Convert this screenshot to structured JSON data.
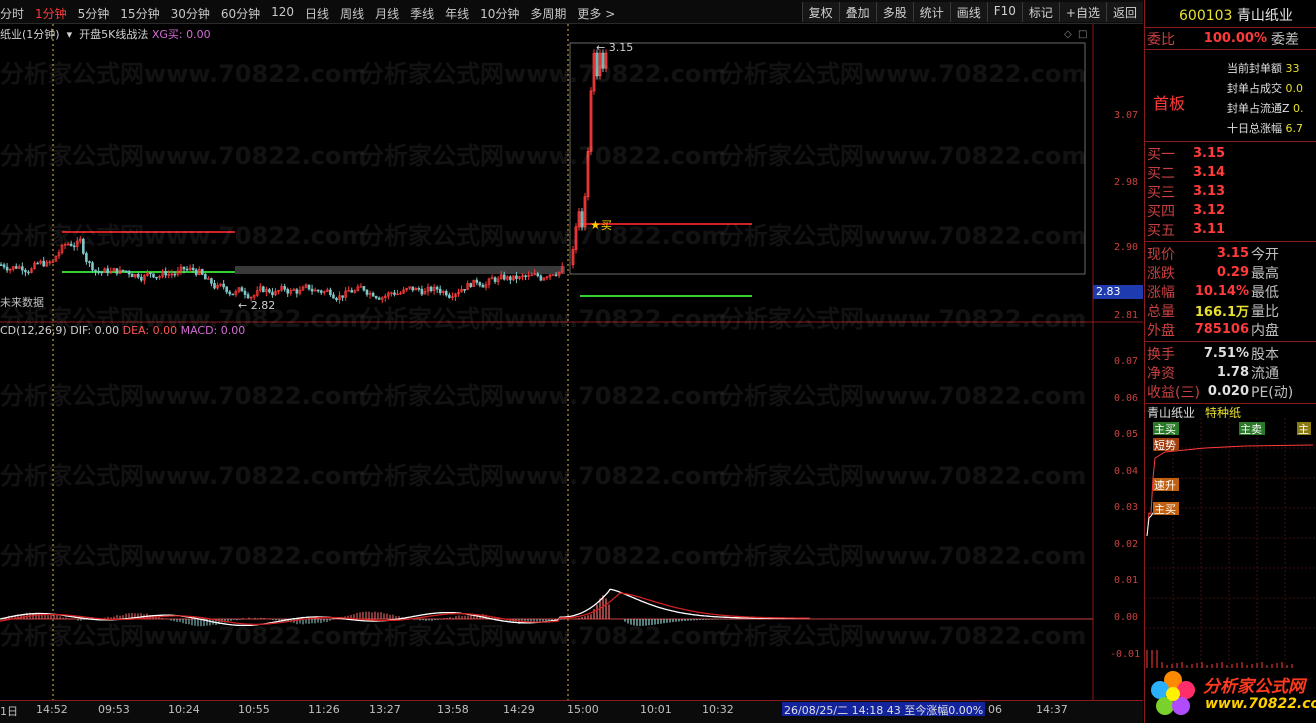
{
  "toolbar": {
    "periods": [
      "分时",
      "1分钟",
      "5分钟",
      "15分钟",
      "30分钟",
      "60分钟",
      "120",
      "日线",
      "周线",
      "月线",
      "季线",
      "年线",
      "10分钟",
      "多周期",
      "更多 >"
    ],
    "active_period": "1分钟",
    "buttons": [
      "复权",
      "叠加",
      "多股",
      "统计",
      "画线",
      "F10",
      "标记",
      "+自选",
      "返回"
    ]
  },
  "chart": {
    "title": "纸业(1分钟)",
    "indicator": "开盘5K线战法",
    "xg_label": "XG买: 0.00",
    "no_data": "未来数据",
    "price_axis": [
      "3.07",
      "2.98",
      "2.90",
      "2.81"
    ],
    "current_price_tag": "2.83",
    "high_mark": "3.15",
    "low_mark": "2.82",
    "buy_mark": "买",
    "macd_title": "CD(12,26,9)",
    "macd_dif": "DIF: 0.00",
    "macd_dea": "DEA: 0.00",
    "macd_macd": "MACD: 0.00",
    "macd_axis": [
      "0.07",
      "0.06",
      "0.05",
      "0.04",
      "0.03",
      "0.02",
      "0.01",
      "0.00",
      "-0.01"
    ],
    "watermark": "分析家公式网www.70822.com"
  },
  "timebar": {
    "labels": [
      "1日",
      "14:52",
      "09:53",
      "10:24",
      "10:55",
      "11:26",
      "13:27",
      "13:58",
      "14:29",
      "15:00",
      "10:01",
      "10:32",
      "06",
      "14:37"
    ],
    "status": "26/08/25/二 14:18 43 至今涨幅0.00%"
  },
  "right_panel": {
    "code": "600103",
    "name": "青山纸业",
    "ratio_label": "委比",
    "ratio_value": "100.00%",
    "ratio_label2": "委差",
    "seal_label": "首板",
    "seal_items": [
      {
        "label": "当前封单额",
        "value": "33"
      },
      {
        "label": "封单占成交",
        "value": "0.0"
      },
      {
        "label": "封单占流通Z",
        "value": "0."
      },
      {
        "label": "十日总涨幅",
        "value": "6.7"
      }
    ],
    "bids": [
      {
        "label": "买一",
        "value": "3.15"
      },
      {
        "label": "买二",
        "value": "3.14"
      },
      {
        "label": "买三",
        "value": "3.13"
      },
      {
        "label": "买四",
        "value": "3.12"
      },
      {
        "label": "买五",
        "value": "3.11"
      }
    ],
    "quote1": [
      {
        "label": "现价",
        "value": "3.15",
        "right": "今开"
      },
      {
        "label": "涨跌",
        "value": "0.29",
        "right": "最高"
      },
      {
        "label": "涨幅",
        "value": "10.14%",
        "right": "最低"
      },
      {
        "label": "总量",
        "value": "166.1万",
        "right": "量比"
      },
      {
        "label": "外盘",
        "value": "785106",
        "right": "内盘"
      }
    ],
    "quote2": [
      {
        "label": "换手",
        "value": "7.51%",
        "right": "股本"
      },
      {
        "label": "净资",
        "value": "1.78",
        "right": "流通"
      },
      {
        "label": "收益(三)",
        "value": "0.020",
        "right": "PE(动)"
      }
    ],
    "tabs": [
      "青山纸业",
      "特种纸"
    ],
    "mini_tags": [
      "主买",
      "主卖",
      "主",
      "短势",
      "速升",
      "主买"
    ],
    "logo_text": "分析家公式网",
    "logo_url": "www.70822.com"
  },
  "colors": {
    "up": "#ff3a3a",
    "down": "#7fc8c8",
    "ma_red": "#d02020",
    "ma_green": "#30d030",
    "dif": "#ffffff",
    "dea": "#d02020",
    "accent_yellow": "#e8e030",
    "status_blue": "#12239c"
  }
}
